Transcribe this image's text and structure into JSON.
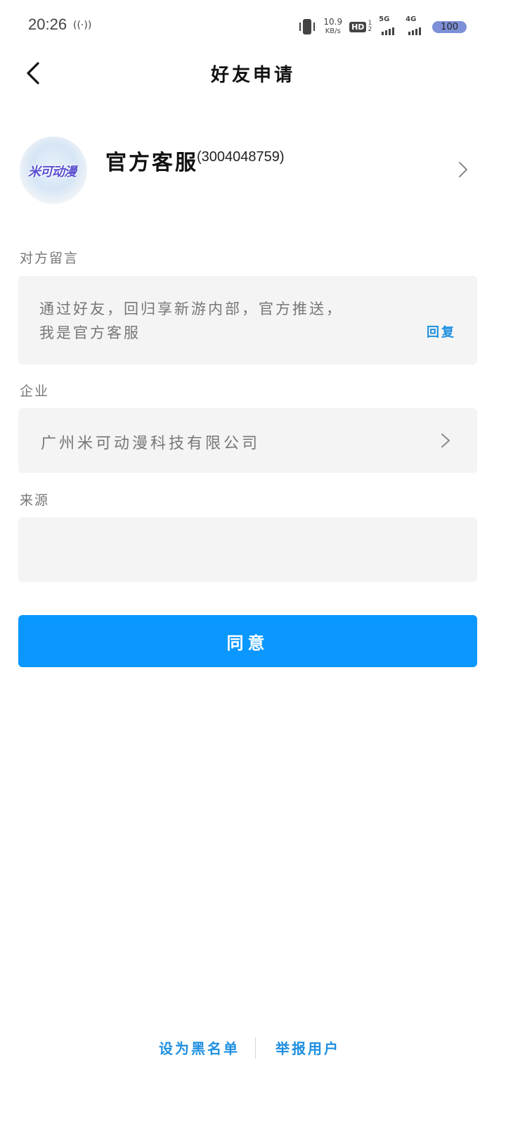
{
  "status_bar": {
    "time": "20:26",
    "hotspot_icon": "((·))",
    "net_speed_value": "10.9",
    "net_speed_unit": "KB/s",
    "hd_label": "HD",
    "hd_sub_top": "1",
    "hd_sub_bottom": "2",
    "sim1_tag": "5G",
    "sim2_tag": "4G",
    "battery": "100",
    "icons": [
      "vibrate-icon",
      "hd-icon",
      "signal-5g-icon",
      "signal-4g-icon",
      "battery-icon"
    ]
  },
  "nav": {
    "back_icon": "chevron-left-icon",
    "title": "好友申请"
  },
  "profile": {
    "avatar_text": "米可动漫",
    "name": "官方客服",
    "id": "(3004048759)",
    "chevron_icon": "chevron-right-icon"
  },
  "message_section": {
    "label": "对方留言",
    "text_line1": "通过好友，回归享新游内部，官方推送，",
    "text_line2": "我是官方客服",
    "reply_label": "回复"
  },
  "company_section": {
    "label": "企业",
    "value": "广州米可动漫科技有限公司",
    "chevron_icon": "chevron-right-icon"
  },
  "source_section": {
    "label": "来源",
    "value": ""
  },
  "agree_button": {
    "label": "同意",
    "color": "#0a97ff"
  },
  "bottom_links": {
    "blacklist_label": "设为黑名单",
    "report_label": "举报用户",
    "link_color": "#1e8fe0"
  }
}
